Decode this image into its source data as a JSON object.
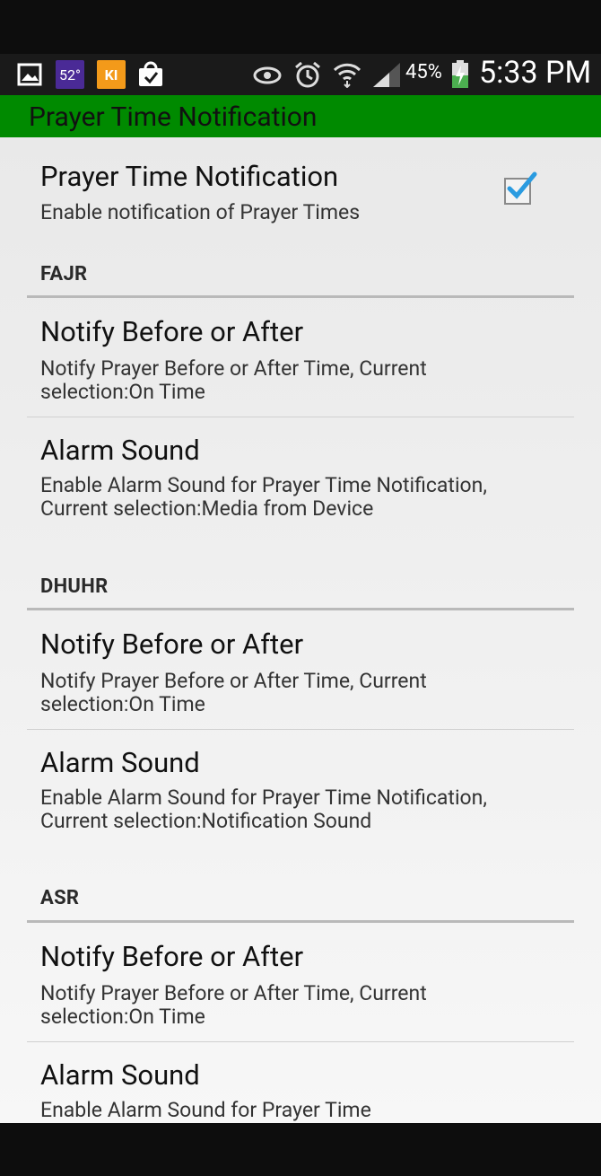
{
  "status_bar": {
    "temperature": "52°",
    "app_badge": "KI",
    "battery_percent": "45%",
    "time": "5:33 PM"
  },
  "app_bar": {
    "title": "Prayer Time Notification"
  },
  "main_toggle": {
    "title": "Prayer Time Notification",
    "summary": "Enable notification of Prayer Times",
    "checked": true
  },
  "sections": [
    {
      "header": "FAJR",
      "notify": {
        "title": "Notify Before or After",
        "summary": "Notify Prayer Before or After Time, Current selection:On Time"
      },
      "alarm": {
        "title": "Alarm Sound",
        "summary": "Enable Alarm Sound for Prayer Time Notification, Current selection:Media from Device"
      }
    },
    {
      "header": "DHUHR",
      "notify": {
        "title": "Notify Before or After",
        "summary": "Notify Prayer Before or After Time, Current selection:On Time"
      },
      "alarm": {
        "title": "Alarm Sound",
        "summary": "Enable Alarm Sound for Prayer Time Notification, Current selection:Notification Sound"
      }
    },
    {
      "header": "ASR",
      "notify": {
        "title": "Notify Before or After",
        "summary": "Notify Prayer Before or After Time, Current selection:On Time"
      },
      "alarm": {
        "title": "Alarm Sound",
        "summary": "Enable Alarm Sound for Prayer Time"
      }
    }
  ],
  "colors": {
    "app_bar": "#008a00",
    "checkmark": "#2a9be0"
  }
}
